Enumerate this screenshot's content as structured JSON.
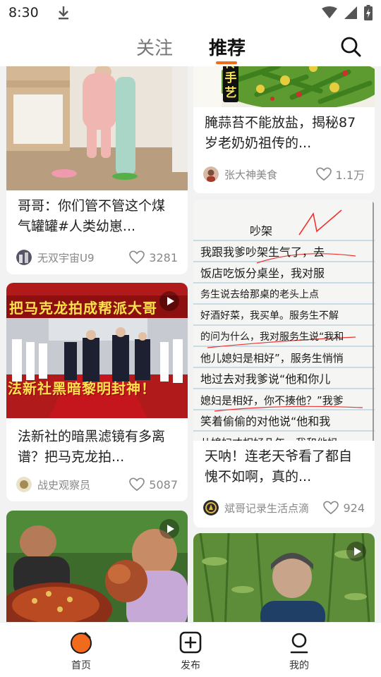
{
  "status": {
    "time": "8:30"
  },
  "header": {
    "tabs": [
      {
        "label": "关注"
      },
      {
        "label": "推荐"
      }
    ]
  },
  "feed": {
    "left": [
      {
        "title": "哥哥：你们管不管这个煤气罐罐#人类幼崽...",
        "author": "无双宇宙U9",
        "likes": "3281",
        "video": false
      },
      {
        "title": "法新社的暗黑滤镜有多离谱？把马克龙拍...",
        "author": "战史观察员",
        "likes": "5087",
        "video": true,
        "overlay_top": "把马克龙拍成帮派大哥",
        "overlay_bottom": "法新社黑暗黎明封神！"
      },
      {
        "video": true
      }
    ],
    "right": [
      {
        "title": "腌蒜苔不能放盐，揭秘87岁老奶奶祖传的...",
        "author": "张大神美食",
        "likes": "1.1万",
        "video": false,
        "overlay": "传手艺"
      },
      {
        "title": "天呐！连老天爷看了都自愧不如啊，真的...",
        "author": "斌哥记录生活点滴",
        "likes": "924",
        "video": false,
        "note_lines": [
          "吵架",
          "我跟我爹吵架生气了，去",
          "饭店吃饭分桌坐，我对服",
          "务生说去给那桌的老头上点",
          "好酒好菜，我买单。服务生不解",
          "的问为什么，我对服务生说“我和",
          "他儿媳妇是相好”，服务生悄悄",
          "地过去对我爹说“他和你儿",
          "媳妇是相好，你不揍他？”我爹",
          "笑着偷偷的对他说“他和我",
          "儿媳妇才相好几年，我和他妈"
        ]
      },
      {
        "video": true
      }
    ]
  },
  "bottom_nav": {
    "items": [
      {
        "label": "首页"
      },
      {
        "label": "发布"
      },
      {
        "label": "我的"
      }
    ]
  },
  "colors": {
    "accent": "#f26a1b",
    "background": "#f2f2f2"
  }
}
